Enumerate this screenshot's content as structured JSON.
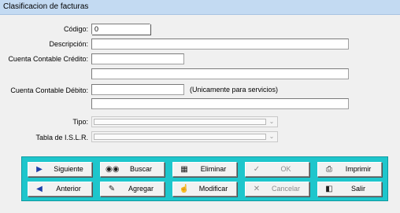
{
  "window": {
    "title": "Clasificacion de facturas"
  },
  "form": {
    "codigo": {
      "label": "Código:",
      "value": "0"
    },
    "descripcion": {
      "label": "Descripción:",
      "value": ""
    },
    "cuenta_credito": {
      "label": "Cuenta Contable Crédito:",
      "value": "",
      "detail": ""
    },
    "cuenta_debito": {
      "label": "Cuenta Contable  Débito:",
      "value": "",
      "detail": "",
      "note": "(Unicamente para servicios)"
    },
    "tipo": {
      "label": "Tipo:",
      "value": ""
    },
    "islr": {
      "label": "Tabla de I.S.L.R.",
      "value": ""
    }
  },
  "toolbar": {
    "siguiente": "Siguiente",
    "buscar": "Buscar",
    "eliminar": "Eliminar",
    "ok": "OK",
    "imprimir": "Imprimir",
    "anterior": "Anterior",
    "agregar": "Agregar",
    "modificar": "Modificar",
    "cancelar": "Cancelar",
    "salir": "Salir"
  },
  "icons": {
    "siguiente": "play-right-icon",
    "buscar": "binoculars-icon",
    "eliminar": "trash-icon",
    "ok": "checkmark-icon",
    "imprimir": "printer-icon",
    "anterior": "play-left-icon",
    "agregar": "pencil-icon",
    "modificar": "edit-hand-icon",
    "cancelar": "x-icon",
    "salir": "exit-door-icon"
  },
  "colors": {
    "titlebar": "#c3daf2",
    "button_panel": "#1ec6cc"
  }
}
